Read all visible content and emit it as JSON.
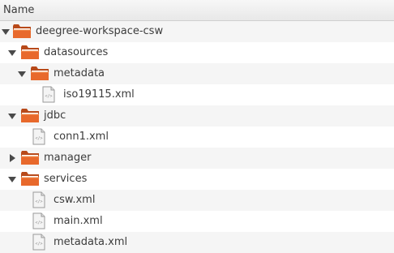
{
  "header": {
    "name_column": "Name"
  },
  "tree": {
    "root": {
      "label": "deegree-workspace-csw",
      "expanded": true,
      "icon": "folder-icon"
    },
    "datasources": {
      "label": "datasources",
      "expanded": true,
      "icon": "folder-icon"
    },
    "metadata_folder": {
      "label": "metadata",
      "expanded": true,
      "icon": "folder-icon"
    },
    "iso_file": {
      "label": "iso19115.xml",
      "icon": "xml-file-icon"
    },
    "jdbc": {
      "label": "jdbc",
      "expanded": true,
      "icon": "folder-icon"
    },
    "conn_file": {
      "label": "conn1.xml",
      "icon": "xml-file-icon"
    },
    "manager": {
      "label": "manager",
      "expanded": false,
      "icon": "folder-icon"
    },
    "services": {
      "label": "services",
      "expanded": true,
      "icon": "folder-icon"
    },
    "csw_file": {
      "label": "csw.xml",
      "icon": "xml-file-icon"
    },
    "main_file": {
      "label": "main.xml",
      "icon": "xml-file-icon"
    },
    "metadata_file": {
      "label": "metadata.xml",
      "icon": "xml-file-icon"
    }
  },
  "colors": {
    "folder_orange": "#e8692c",
    "folder_back": "#b84a1a",
    "row_stripe": "#f5f5f5"
  }
}
